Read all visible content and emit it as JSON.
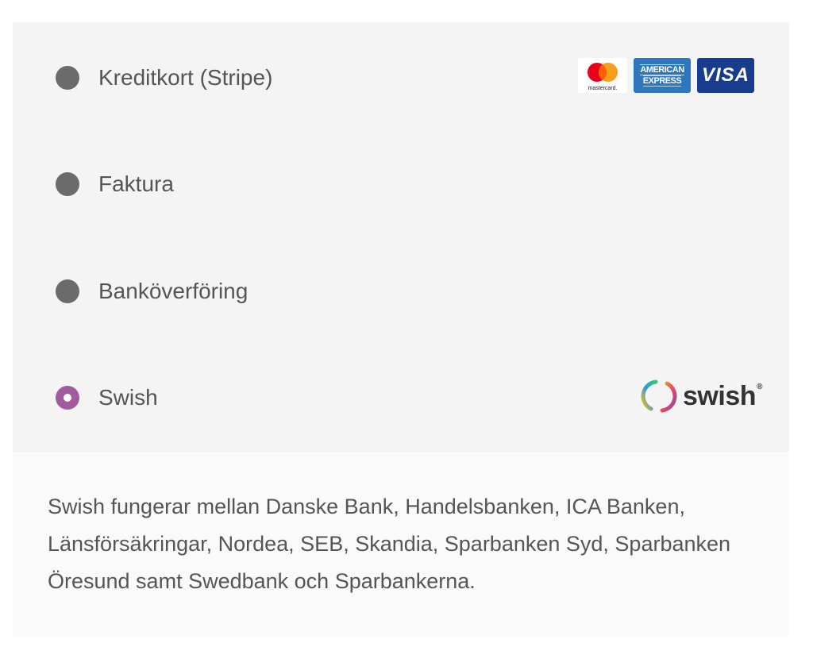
{
  "payment_methods": [
    {
      "label": "Kreditkort (Stripe)",
      "selected": false,
      "logos": [
        "mastercard",
        "american-express",
        "visa"
      ]
    },
    {
      "label": "Faktura",
      "selected": false
    },
    {
      "label": "Banköverföring",
      "selected": false
    },
    {
      "label": "Swish",
      "selected": true,
      "logos": [
        "swish"
      ]
    }
  ],
  "logos": {
    "mastercard_text": "mastercard.",
    "amex_line1": "AMERICAN",
    "amex_line2": "EXPRESS",
    "visa_text": "VISA",
    "swish_text": "swish",
    "swish_mark": "®"
  },
  "description": "Swish fungerar mellan Danske Bank, Handelsbanken, ICA Banken, Länsförsäkringar, Nordea, SEB, Skandia, Sparbanken Syd, Sparbanken Öresund samt Swedbank och Sparbankerna.",
  "colors": {
    "radio_default": "#6b6b6b",
    "radio_selected": "#a05c9f",
    "panel_bg": "#f4f4f4",
    "description_bg": "#fafafa",
    "text": "#555555"
  }
}
